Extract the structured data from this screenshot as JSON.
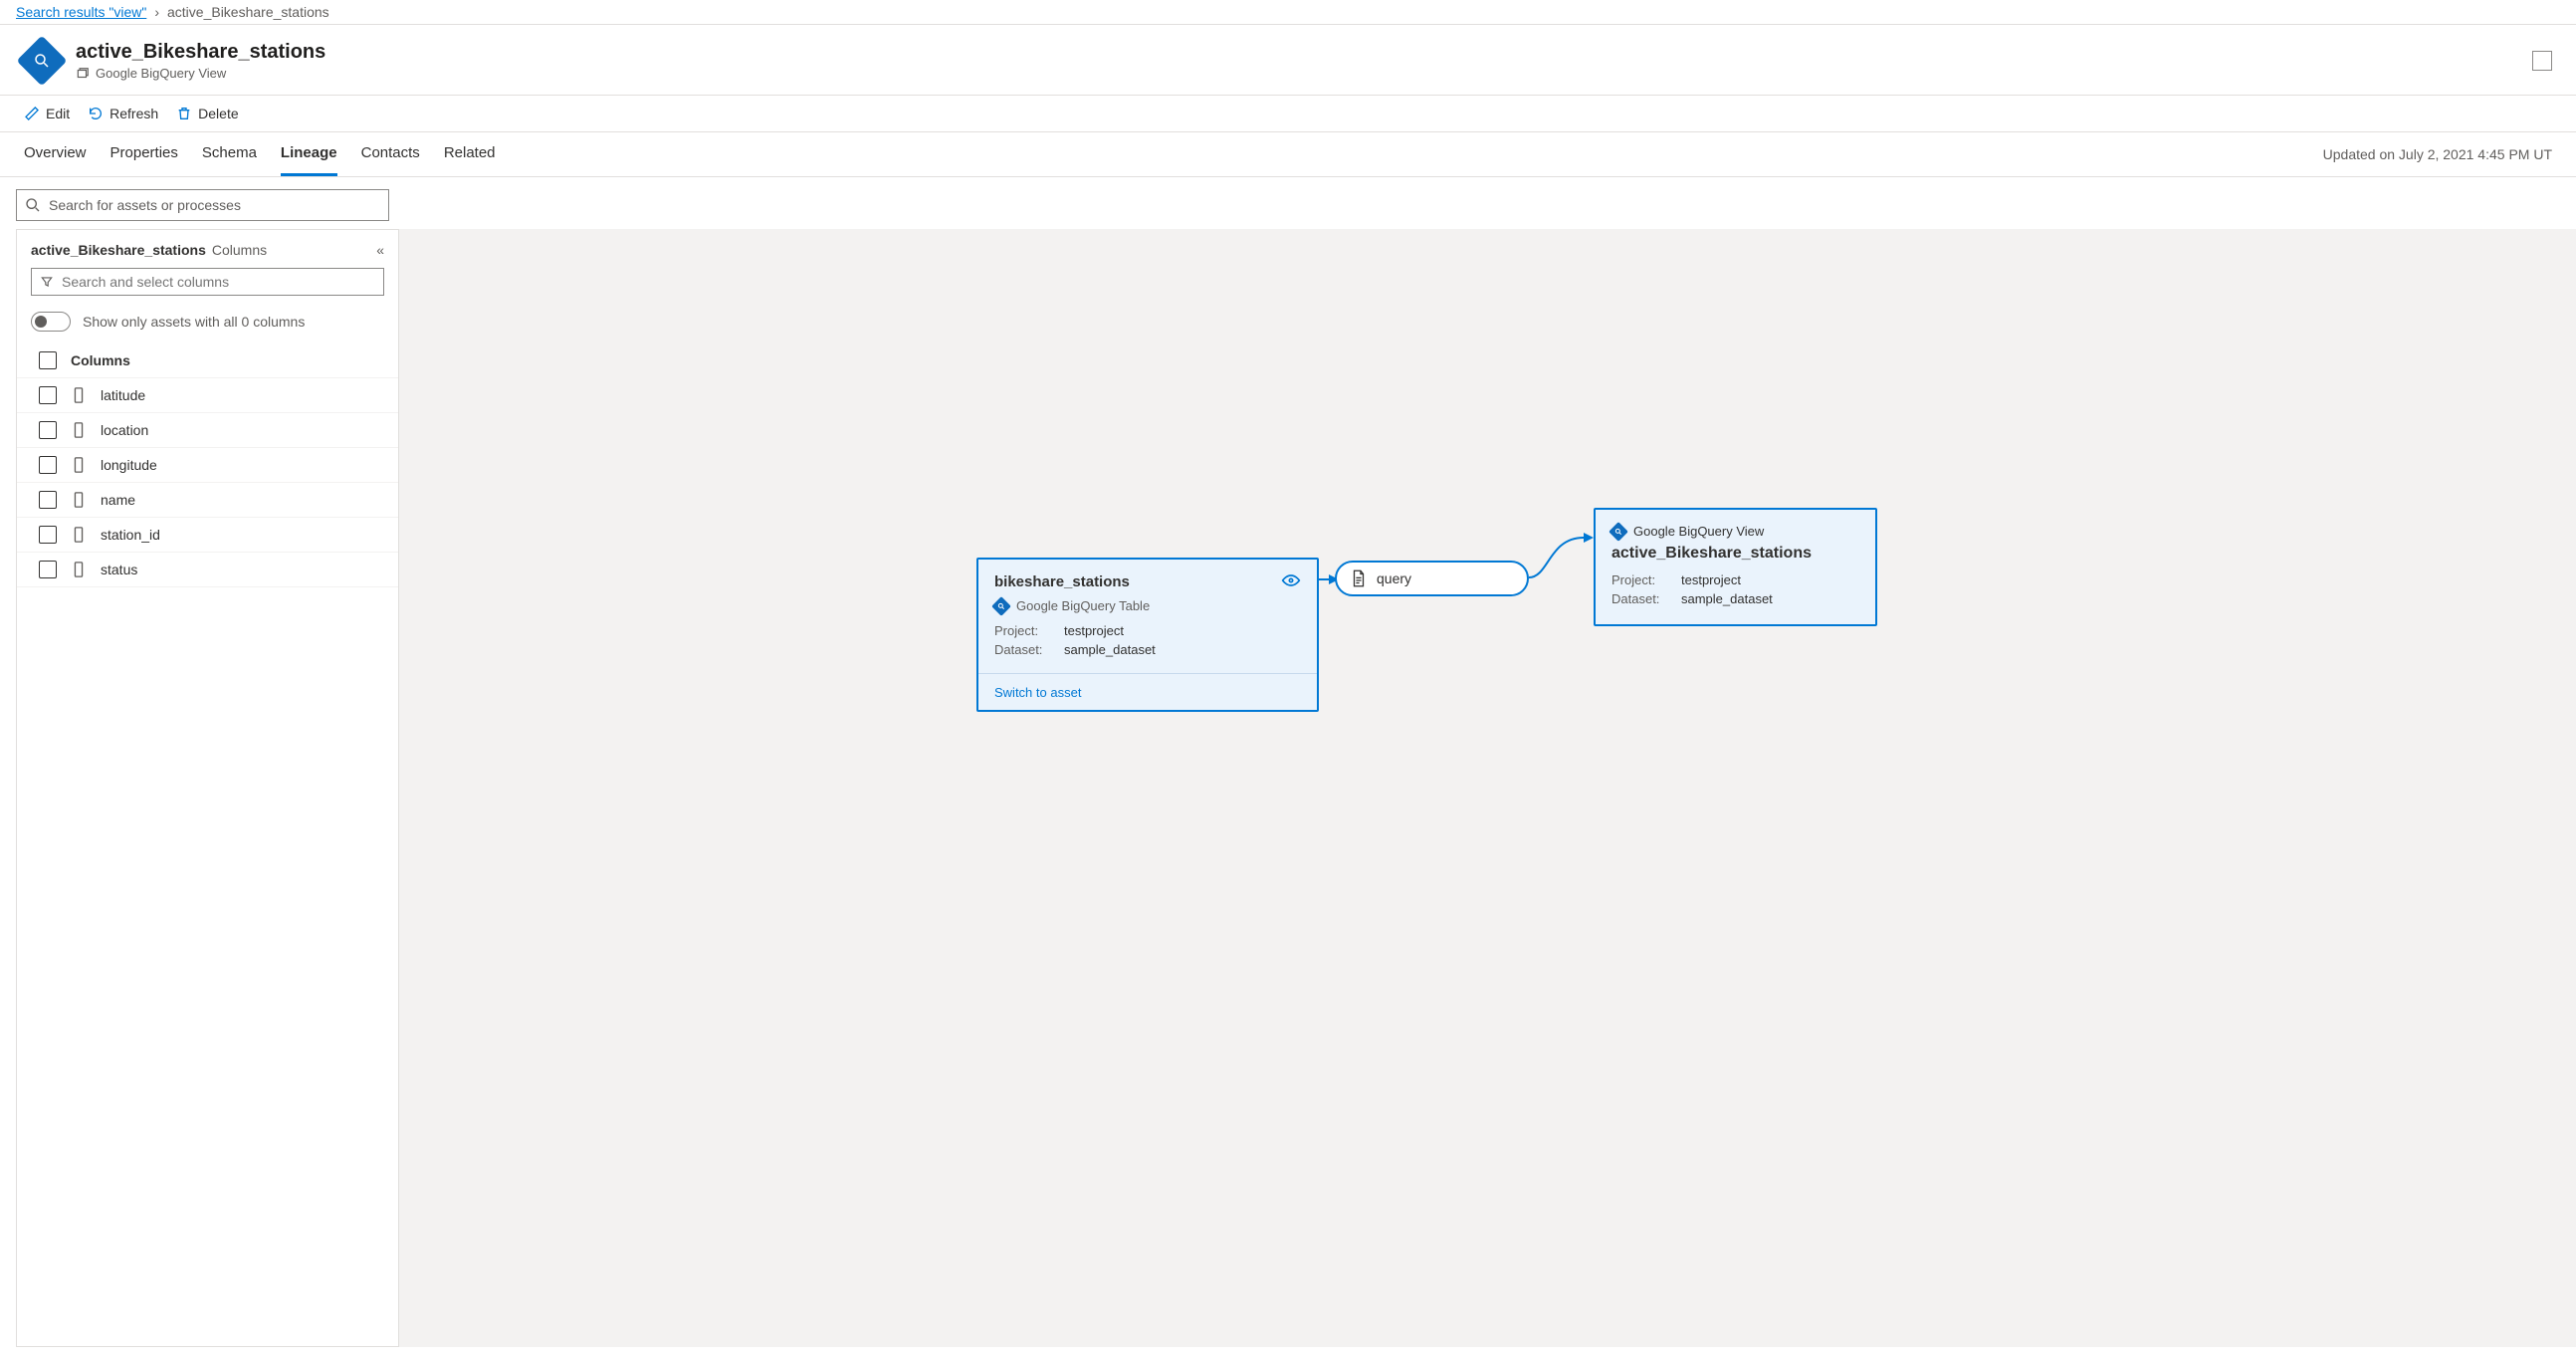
{
  "breadcrumb": {
    "link": "Search results \"view\"",
    "current": "active_Bikeshare_stations"
  },
  "header": {
    "title": "active_Bikeshare_stations",
    "subtitle": "Google BigQuery View"
  },
  "toolbar": {
    "edit": "Edit",
    "refresh": "Refresh",
    "delete": "Delete"
  },
  "tabs": {
    "overview": "Overview",
    "properties": "Properties",
    "schema": "Schema",
    "lineage": "Lineage",
    "contacts": "Contacts",
    "related": "Related"
  },
  "updated": "Updated on July 2, 2021 4:45 PM UT",
  "search": {
    "placeholder": "Search for assets or processes"
  },
  "panel": {
    "title": "active_Bikeshare_stations",
    "subtitle": "Columns",
    "searchPlaceholder": "Search and select columns",
    "toggleLabel": "Show only assets with all 0 columns",
    "columnsHeader": "Columns",
    "columns": [
      {
        "name": "latitude"
      },
      {
        "name": "location"
      },
      {
        "name": "longitude"
      },
      {
        "name": "name"
      },
      {
        "name": "station_id"
      },
      {
        "name": "status"
      }
    ]
  },
  "lineage": {
    "source": {
      "title": "bikeshare_stations",
      "type": "Google BigQuery Table",
      "projectLabel": "Project:",
      "project": "testproject",
      "datasetLabel": "Dataset:",
      "dataset": "sample_dataset",
      "switch": "Switch to asset"
    },
    "query": {
      "label": "query"
    },
    "target": {
      "type": "Google BigQuery View",
      "title": "active_Bikeshare_stations",
      "projectLabel": "Project:",
      "project": "testproject",
      "datasetLabel": "Dataset:",
      "dataset": "sample_dataset"
    }
  }
}
